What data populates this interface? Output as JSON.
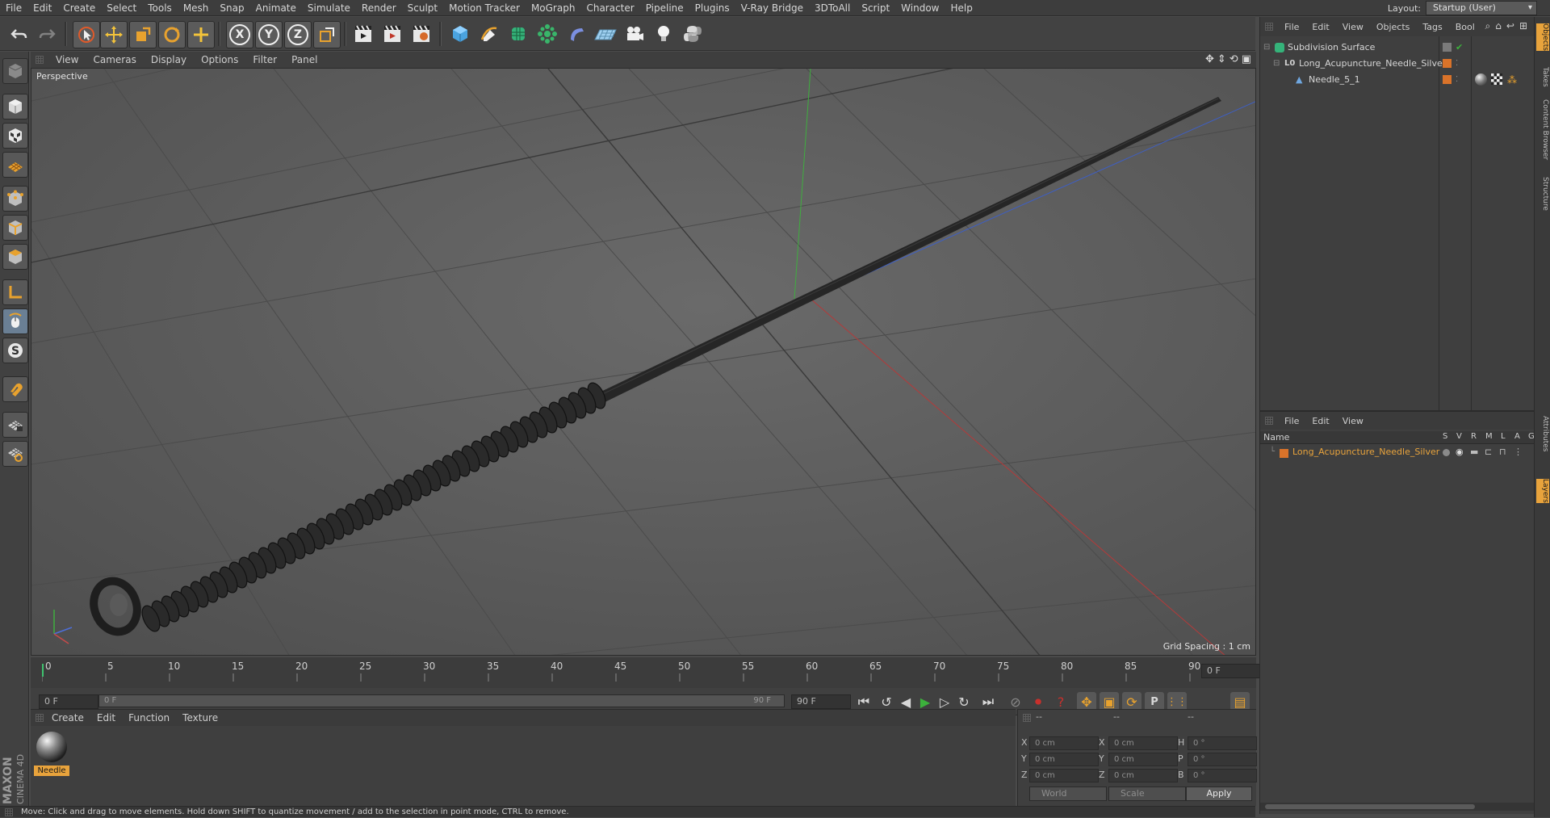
{
  "menubar": {
    "items": [
      "File",
      "Edit",
      "Create",
      "Select",
      "Tools",
      "Mesh",
      "Snap",
      "Animate",
      "Simulate",
      "Render",
      "Sculpt",
      "Motion Tracker",
      "MoGraph",
      "Character",
      "Pipeline",
      "Plugins",
      "V-Ray Bridge",
      "3DToAll",
      "Script",
      "Window",
      "Help"
    ],
    "layout_label": "Layout:",
    "layout_value": "Startup (User)"
  },
  "toolbar": {
    "axis_x": "X",
    "axis_y": "Y",
    "axis_z": "Z"
  },
  "viewport": {
    "menu": [
      "View",
      "Cameras",
      "Display",
      "Options",
      "Filter",
      "Panel"
    ],
    "camera_label": "Perspective",
    "grid_spacing": "Grid Spacing : 1 cm"
  },
  "timeline": {
    "ticks": [
      "0",
      "5",
      "10",
      "15",
      "20",
      "25",
      "30",
      "35",
      "40",
      "45",
      "50",
      "55",
      "60",
      "65",
      "70",
      "75",
      "80",
      "85",
      "90"
    ],
    "current_frame_field": "0 F",
    "start_field": "0 F",
    "range_start": "0 F",
    "range_end": "90 F",
    "end_field": "90 F"
  },
  "material_manager": {
    "menu": [
      "Create",
      "Edit",
      "Function",
      "Texture"
    ],
    "material_name": "Needle"
  },
  "coordinates": {
    "headers": [
      "--",
      "--",
      "--"
    ],
    "rows": [
      {
        "a": "X",
        "v1": "0 cm",
        "b": "X",
        "v2": "0 cm",
        "c": "H",
        "v3": "0 °"
      },
      {
        "a": "Y",
        "v1": "0 cm",
        "b": "Y",
        "v2": "0 cm",
        "c": "P",
        "v3": "0 °"
      },
      {
        "a": "Z",
        "v1": "0 cm",
        "b": "Z",
        "v2": "0 cm",
        "c": "B",
        "v3": "0 °"
      }
    ],
    "world_dropdown": "World",
    "scale_dropdown": "Scale",
    "apply_label": "Apply"
  },
  "status_bar": {
    "text": "Move: Click and drag to move elements. Hold down SHIFT to quantize movement / add to the selection in point mode, CTRL to remove."
  },
  "object_manager": {
    "menu": [
      "File",
      "Edit",
      "View",
      "Objects",
      "Tags",
      "Bool"
    ],
    "objects": [
      {
        "name": "Subdivision Surface"
      },
      {
        "name": "Long_Acupuncture_Needle_Silver"
      },
      {
        "name": "Needle_5_1"
      }
    ]
  },
  "layer_manager": {
    "menu": [
      "File",
      "Edit",
      "View"
    ],
    "col_name": "Name",
    "col_flags": [
      "S",
      "V",
      "R",
      "M",
      "L",
      "A",
      "G"
    ],
    "layer_name": "Long_Acupuncture_Needle_Silver"
  },
  "side_tabs": [
    "Objects",
    "Takes",
    "Content Browser",
    "Structure",
    "Attributes",
    "Layers"
  ],
  "logo": "MAXON CINEMA 4D",
  "colors": {
    "accent_orange": "#d9732a",
    "selection_yellow": "#e8a33c",
    "play_green": "#3cb13c",
    "record_red": "#c8302c"
  }
}
